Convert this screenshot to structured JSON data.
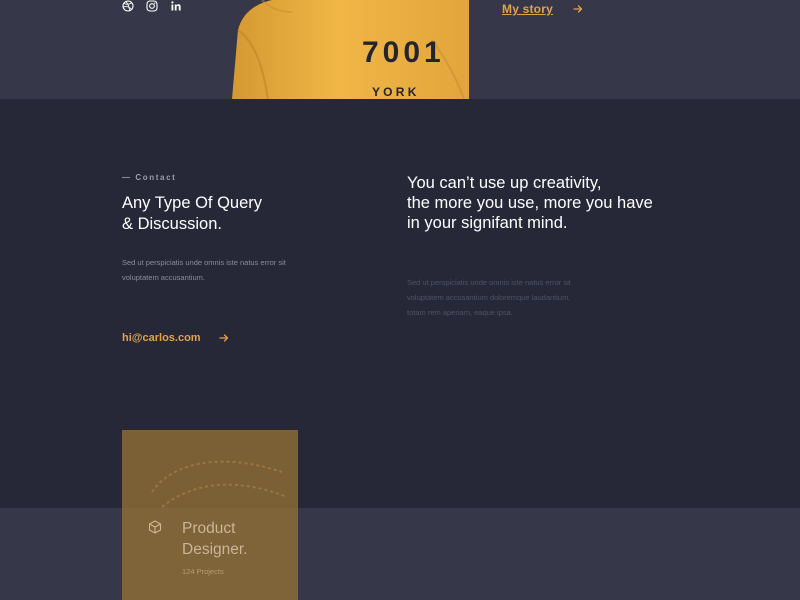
{
  "colors": {
    "accent": "#e3a14b",
    "background": "#262838",
    "band": "#363849",
    "card": "#94703599"
  },
  "header": {
    "socials": [
      {
        "name": "dribbble",
        "icon": "dribbble-icon"
      },
      {
        "name": "instagram",
        "icon": "instagram-icon"
      },
      {
        "name": "linkedin",
        "icon": "linkedin-icon"
      }
    ],
    "portrait_shirt_text": [
      "7001",
      "Y O R K"
    ],
    "my_story_label": "My story"
  },
  "contact": {
    "tag": "— Contact",
    "title_line1": "Any Type Of Query",
    "title_line2": "& Discussion.",
    "desc_line1": "Sed ut perspiciatis unde omnis iste natus error sit",
    "desc_line2": "voluptatem accusantium.",
    "email": "hi@carlos.com"
  },
  "quote": {
    "line1": "You can’t use up creativity,",
    "line2": "the more you use, more you have",
    "line3": "in your signifant mind.",
    "desc_line1": "Sed ut perspiciatis unde omnis iste natus error sit",
    "desc_line2": "voluptatem accusantium doloremque laudantium,",
    "desc_line3": "totam rem aperiam, eaque ipsa."
  },
  "card": {
    "title_line1": "Product",
    "title_line2": "Designer.",
    "projects": "124 Projects"
  }
}
